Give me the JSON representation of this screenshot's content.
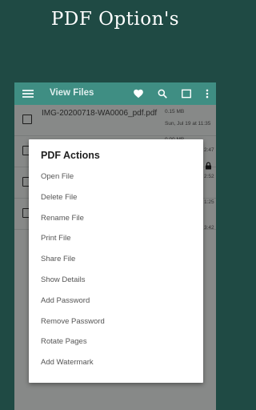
{
  "headline": "PDF Option's",
  "appbar": {
    "title": "View Files",
    "menu_icon": "hamburger-menu-icon",
    "icons": [
      "heart-icon",
      "search-icon",
      "select-all-square-icon",
      "more-vert-icon"
    ]
  },
  "file": {
    "name": "IMG-20200718-WA0006_pdf.pdf",
    "size": "0.15 MB",
    "date": "Sun, Jul 19 at 11:35"
  },
  "row2_size": "0.00 MB",
  "peeks": [
    "2:47",
    "2:52",
    "1:25",
    "3:42"
  ],
  "dialog": {
    "title": "PDF Actions",
    "items": [
      "Open File",
      "Delete File",
      "Rename File",
      "Print File",
      "Share File",
      "Show Details",
      "Add Password",
      "Remove Password",
      "Rotate Pages",
      "Add Watermark"
    ]
  },
  "colors": {
    "background": "#1f4a44",
    "appbar": "#3f8e83",
    "dialog": "#ffffff"
  }
}
